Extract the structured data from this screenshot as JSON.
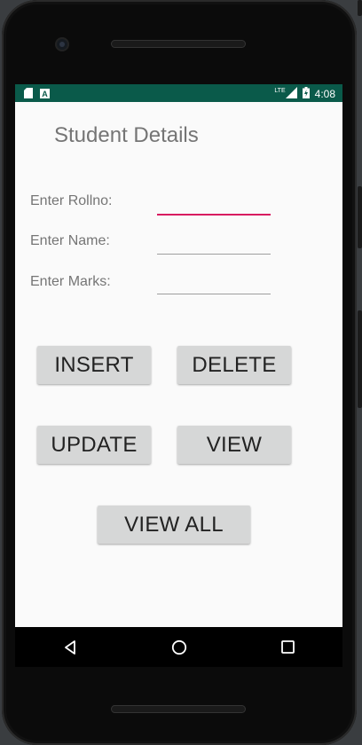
{
  "statusbar": {
    "time": "4:08",
    "network": "LTE",
    "icons": [
      "sd-card-icon",
      "notification-a-icon",
      "signal-icon",
      "battery-icon"
    ]
  },
  "app": {
    "title": "Student Details"
  },
  "form": {
    "rollno_label": "Enter Rollno:",
    "name_label": "Enter Name:",
    "marks_label": "Enter Marks:",
    "rollno_value": "",
    "name_value": "",
    "marks_value": ""
  },
  "buttons": {
    "insert": "INSERT",
    "delete": "DELETE",
    "update": "UPDATE",
    "view": "VIEW",
    "view_all": "VIEW ALL"
  },
  "navbar": {
    "icons": [
      "back-icon",
      "home-icon",
      "recents-icon"
    ]
  },
  "colors": {
    "statusbar": "#0a5a4a",
    "accent": "#d81b60",
    "button": "#d6d7d7"
  }
}
